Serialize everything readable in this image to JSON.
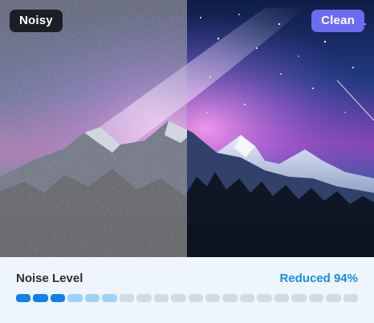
{
  "compare": {
    "before_label": "Noisy",
    "after_label": "Clean",
    "before_icon": "noisy-night-sky-mountain-image",
    "after_icon": "clean-night-sky-mountain-image"
  },
  "meter": {
    "label": "Noise Level",
    "status": "Reduced 94%",
    "segments_total": 20,
    "segments_strong": 3,
    "segments_soft": 3
  },
  "colors": {
    "accent": "#1180e8",
    "accent_soft": "#9fd2f7",
    "inactive": "#d3dae3",
    "status_text": "#1a8ce6",
    "clean_badge": "#6b6bf0",
    "noisy_badge": "#0f1218"
  }
}
